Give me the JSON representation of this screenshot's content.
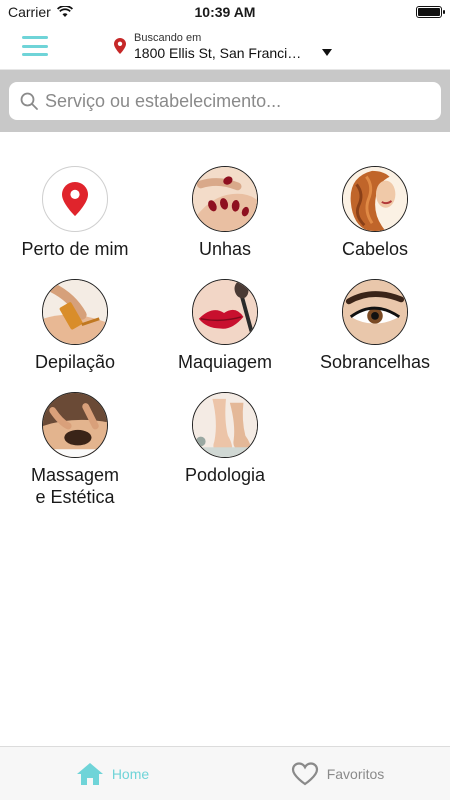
{
  "status_bar": {
    "carrier": "Carrier",
    "time": "10:39 AM",
    "battery_level": 1.0
  },
  "header": {
    "menu_icon": "hamburger-menu-icon",
    "location_label": "Buscando em",
    "location_address": "1800 Ellis St, San Francisco, CA",
    "accent_color": "#6fd4d8",
    "pin_color": "#e0242c"
  },
  "search": {
    "placeholder": "Serviço ou estabelecimento...",
    "value": ""
  },
  "categories": [
    {
      "label": "Perto de mim",
      "icon": "location-pin-icon"
    },
    {
      "label": "Unhas",
      "icon": "nails-photo"
    },
    {
      "label": "Cabelos",
      "icon": "hair-photo"
    },
    {
      "label": "Depilação",
      "icon": "waxing-photo"
    },
    {
      "label": "Maquiagem",
      "icon": "makeup-photo"
    },
    {
      "label": "Sobrancelhas",
      "icon": "eyebrow-photo"
    },
    {
      "label": "Massagem\ne Estética",
      "icon": "massage-photo"
    },
    {
      "label": "Podologia",
      "icon": "feet-photo"
    }
  ],
  "tabbar": {
    "home_label": "Home",
    "favorites_label": "Favoritos",
    "active_tab": "Home"
  }
}
